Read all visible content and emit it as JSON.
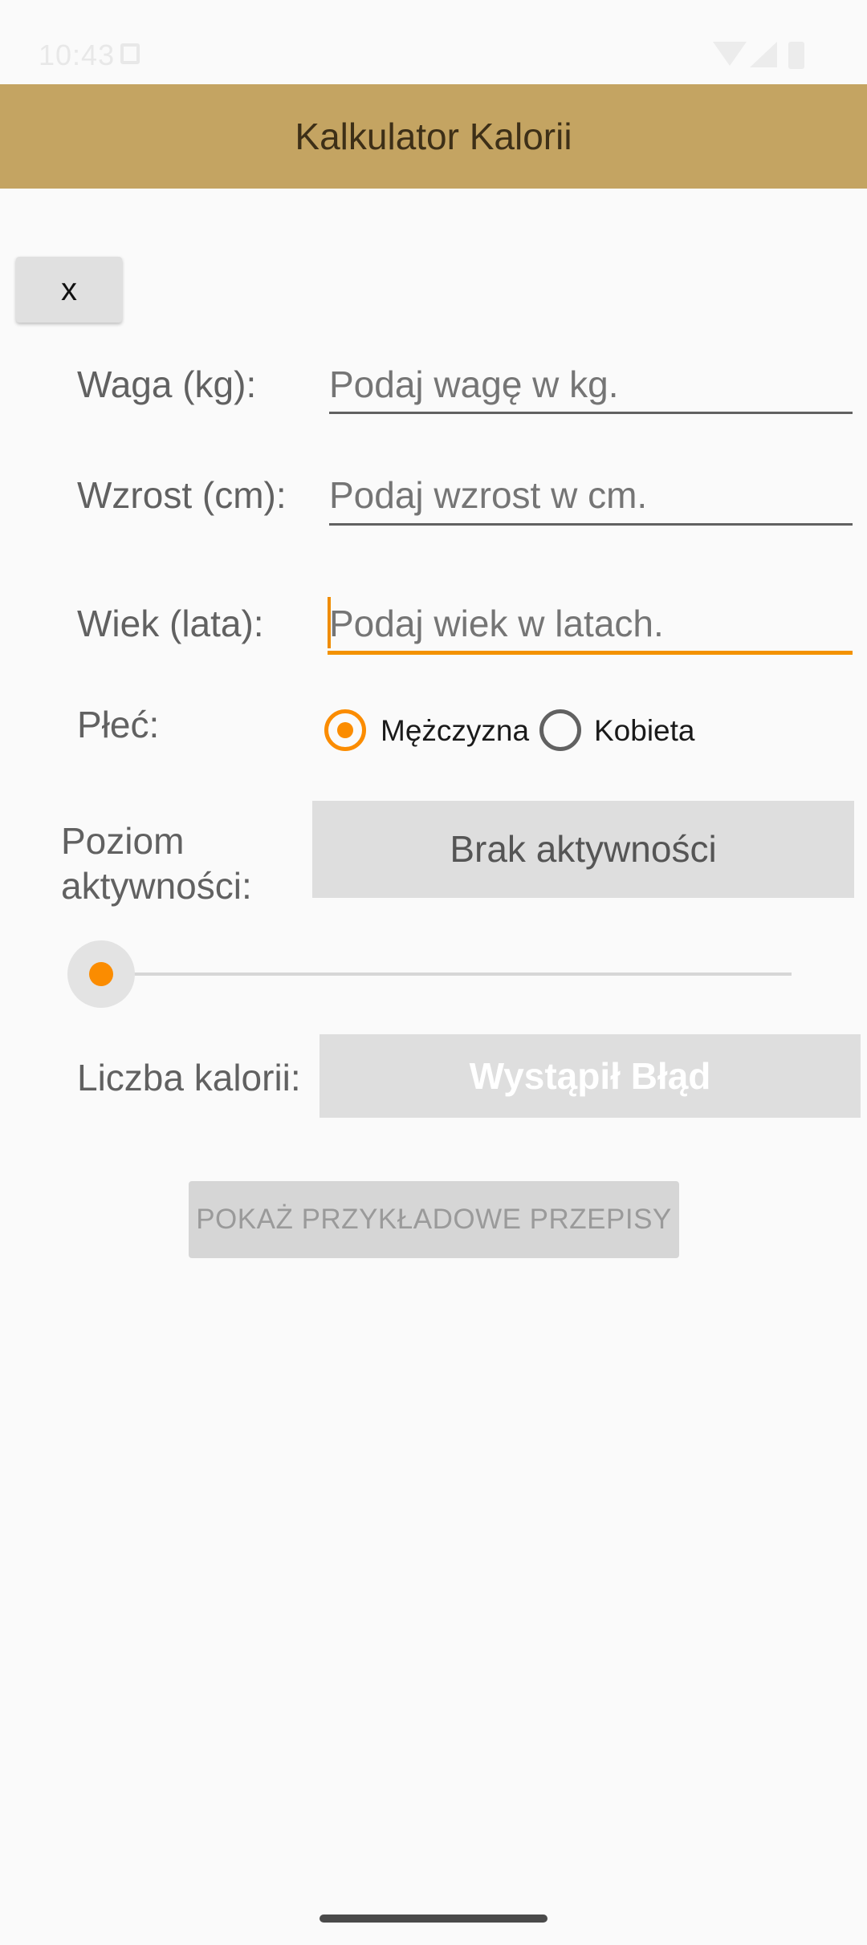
{
  "status_bar": {
    "time": "10:43"
  },
  "app_bar": {
    "title": "Kalkulator Kalorii",
    "color": "#c4a462"
  },
  "close_button": {
    "label": "x"
  },
  "form": {
    "weight": {
      "label": "Waga (kg):",
      "placeholder": "Podaj wagę w kg."
    },
    "height": {
      "label": "Wzrost (cm):",
      "placeholder": "Podaj wzrost w cm."
    },
    "age": {
      "label": "Wiek (lata):",
      "placeholder": "Podaj wiek w latach.",
      "focused": true
    },
    "gender": {
      "label": "Płeć:",
      "options": [
        "Mężczyzna",
        "Kobieta"
      ],
      "selected": "Mężczyzna"
    },
    "activity": {
      "label": "Poziom aktywności:",
      "selected": "Brak aktywności",
      "slider_value": 0
    },
    "calories": {
      "label": "Liczba kalorii:",
      "value": "Wystąpił Błąd"
    }
  },
  "recipes_button": {
    "label": "POKAŻ PRZYKŁADOWE PRZEPISY",
    "enabled": false
  },
  "accent_color": "#fb8c00"
}
